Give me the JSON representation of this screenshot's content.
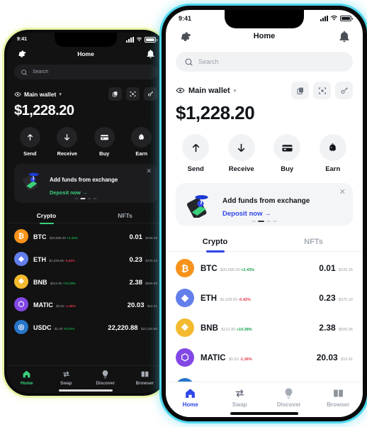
{
  "status_bar": {
    "time": "9:41"
  },
  "header": {
    "title": "Home",
    "settings_icon": "gear-icon",
    "bell_icon": "bell-icon"
  },
  "search": {
    "placeholder": "Search",
    "value": "",
    "icon": "search-icon"
  },
  "wallet": {
    "name": "Main wallet",
    "eye_icon": "eye-icon",
    "caret": "▾",
    "balance": "$1,228.20",
    "actions": [
      {
        "name": "copy-address-button",
        "icon": "copy-icon"
      },
      {
        "name": "scan-qr-button",
        "icon": "scan-icon"
      },
      {
        "name": "connect-button",
        "icon": "link-icon"
      }
    ]
  },
  "quick_actions": [
    {
      "label": "Send",
      "icon": "arrow-up-icon"
    },
    {
      "label": "Receive",
      "icon": "arrow-down-icon"
    },
    {
      "label": "Buy",
      "icon": "credit-card-icon"
    },
    {
      "label": "Earn",
      "icon": "piggy-bank-icon"
    }
  ],
  "promo": {
    "title": "Add funds from exchange",
    "cta": "Deposit now  →",
    "close": "✕",
    "art_icon": "phone-deposit-illustration"
  },
  "tabs": [
    {
      "label": "Crypto",
      "active": true
    },
    {
      "label": "NFTs",
      "active": false
    }
  ],
  "assets": [
    {
      "symbol": "BTC",
      "price": "$26,685.00",
      "change": "+2.43%",
      "direction": "up",
      "amount": "0.01",
      "value": "$226.25",
      "color": "#f7931a",
      "glyph": "₿"
    },
    {
      "symbol": "ETH",
      "price": "$1,628.65",
      "change": "-0.42%",
      "direction": "down",
      "amount": "0.23",
      "value": "$375.33",
      "color": "#627eea",
      "glyph": "◆"
    },
    {
      "symbol": "BNB",
      "price": "$212.80",
      "change": "+10.38%",
      "direction": "up",
      "amount": "2.38",
      "value": "$506.95",
      "color": "#f3ba2f",
      "glyph": "❖"
    },
    {
      "symbol": "MATIC",
      "price": "$0.52",
      "change": "-1.36%",
      "direction": "down",
      "amount": "20.03",
      "value": "$10.41",
      "color": "#8247e5",
      "glyph": "⬡"
    },
    {
      "symbol": "USDC",
      "price": "$1.00",
      "change": "+0.01%",
      "direction": "up",
      "amount": "22,220.88",
      "value": "$22,220.88",
      "color": "#2775ca",
      "glyph": "◎"
    }
  ],
  "bottom_nav": [
    {
      "label": "Home",
      "icon": "home-icon",
      "active": true
    },
    {
      "label": "Swap",
      "icon": "swap-icon",
      "active": false
    },
    {
      "label": "Discover",
      "icon": "bulb-icon",
      "active": false
    },
    {
      "label": "Browser",
      "icon": "browser-icon",
      "active": false
    }
  ],
  "theme": {
    "light_accent": "#2f46e8",
    "dark_accent": "#3ad17c",
    "up_color": "#16a34a",
    "down_color": "#e0384a",
    "light_frame_glow": "#4fd8ef",
    "dark_frame_glow": "#e9f5a8"
  }
}
